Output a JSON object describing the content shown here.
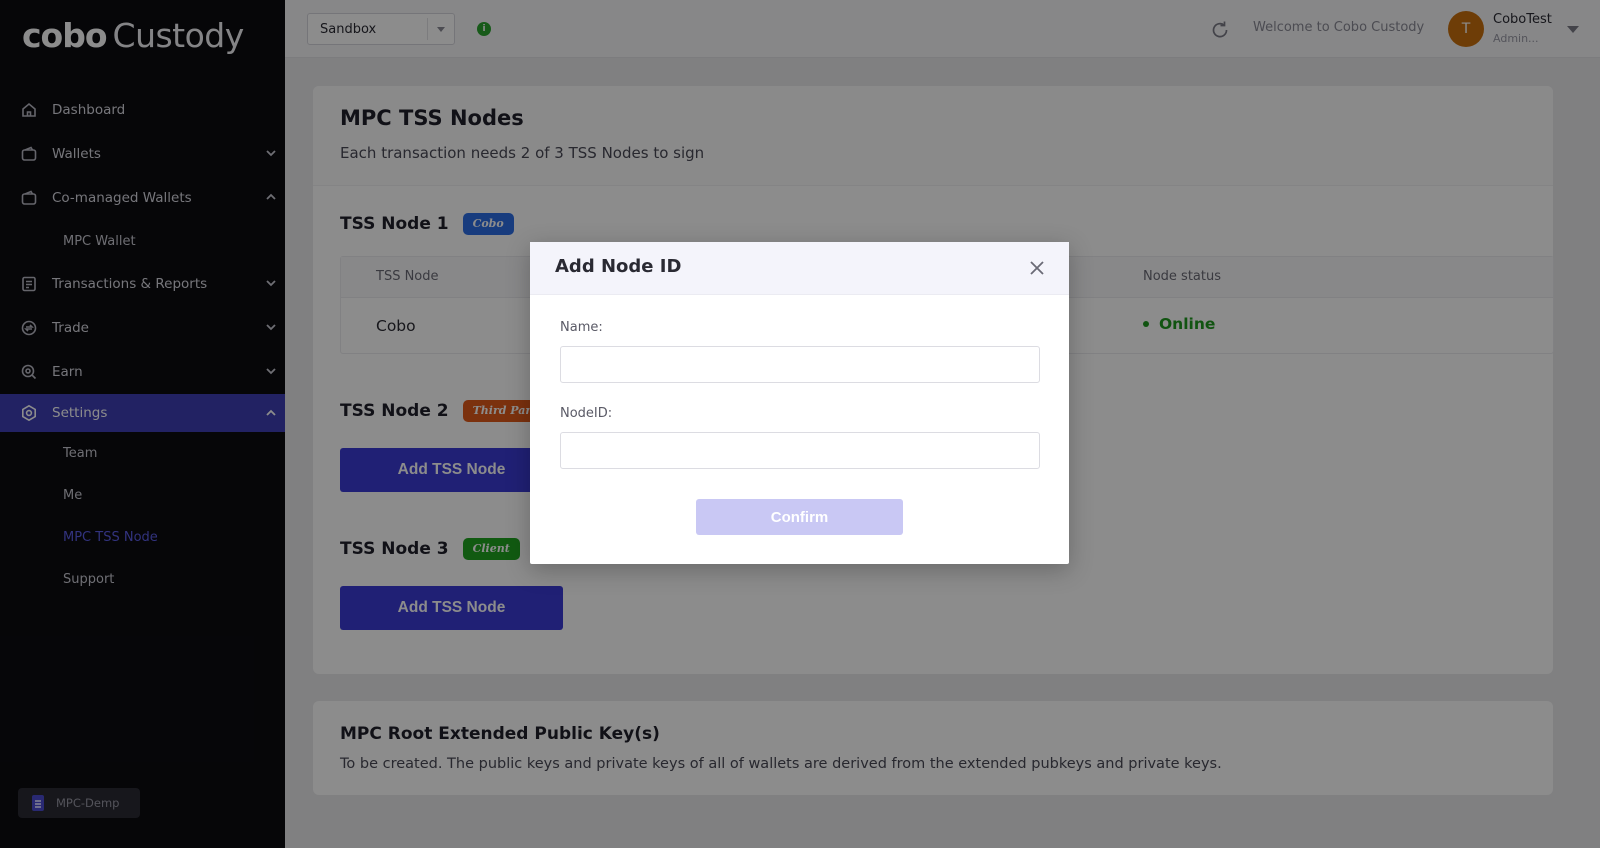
{
  "brand": {
    "logo_bold": "cobo",
    "logo_light": "Custody"
  },
  "sidebar": {
    "items": [
      {
        "label": "Dashboard"
      },
      {
        "label": "Wallets"
      },
      {
        "label": "Co-managed Wallets"
      },
      {
        "label": "MPC Wallet"
      },
      {
        "label": "Transactions & Reports"
      },
      {
        "label": "Trade"
      },
      {
        "label": "Earn"
      },
      {
        "label": "Settings"
      },
      {
        "label": "Team"
      },
      {
        "label": "Me"
      },
      {
        "label": "MPC TSS Node"
      },
      {
        "label": "Support"
      }
    ],
    "env_badge": "MPC-Demp"
  },
  "topbar": {
    "environment": "Sandbox",
    "info_icon_glyph": "i",
    "welcome": "Welcome to Cobo Custody",
    "avatar_initial": "T",
    "user_name": "CoboTest",
    "user_role": "Admin..."
  },
  "main": {
    "title": "MPC TSS Nodes",
    "subtitle": "Each transaction needs 2 of 3 TSS Nodes to sign",
    "node1": {
      "title": "TSS Node 1",
      "tag": "Cobo"
    },
    "table": {
      "col_node": "TSS Node",
      "col_status": "Node status",
      "row_node": "Cobo",
      "row_status": "Online"
    },
    "node2": {
      "title": "TSS Node 2",
      "tag": "Third Party",
      "button": "Add TSS Node"
    },
    "node3": {
      "title": "TSS Node 3",
      "tag": "Client",
      "button": "Add TSS Node"
    },
    "root_key": {
      "title": "MPC Root Extended Public Key(s)",
      "text": "To be created. The public keys and private keys of all of wallets are derived from the extended pubkeys and private keys."
    }
  },
  "modal": {
    "title": "Add Node ID",
    "name_label": "Name:",
    "name_value": "",
    "nodeid_label": "NodeID:",
    "nodeid_value": "",
    "confirm": "Confirm"
  },
  "colors": {
    "sidebar_bg": "#0b0b10",
    "accent": "#3b3bd6",
    "online": "#1f9a1f",
    "avatar": "#c8700e"
  }
}
